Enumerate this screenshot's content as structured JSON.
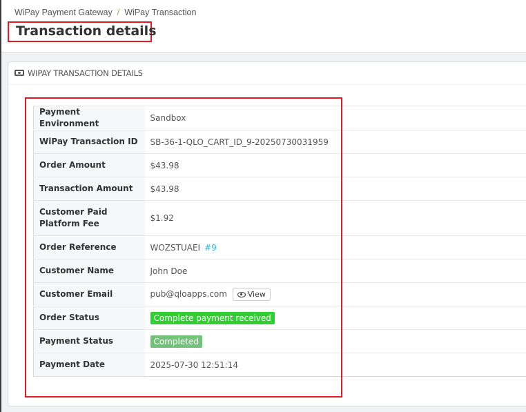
{
  "breadcrumb": {
    "items": [
      "WiPay Payment Gateway",
      "WiPay Transaction"
    ],
    "separator": "/"
  },
  "page": {
    "title": "Transaction details"
  },
  "panel": {
    "title": "WIPAY TRANSACTION DETAILS",
    "icon": "money-icon"
  },
  "details": {
    "payment_environment": {
      "label": "Payment Environment",
      "value": "Sandbox"
    },
    "transaction_id": {
      "label": "WiPay Transaction ID",
      "value": "SB-36-1-QLO_CART_ID_9-20250730031959"
    },
    "order_amount": {
      "label": "Order Amount",
      "value": "$43.98"
    },
    "transaction_amount": {
      "label": "Transaction Amount",
      "value": "$43.98"
    },
    "platform_fee": {
      "label": "Customer Paid Platform Fee",
      "value": "$1.92"
    },
    "order_reference": {
      "label": "Order Reference",
      "value": "WOZSTUAEI",
      "link": "#9"
    },
    "customer_name": {
      "label": "Customer Name",
      "value": "John Doe"
    },
    "customer_email": {
      "label": "Customer Email",
      "value": "pub@qloapps.com",
      "button": "View"
    },
    "order_status": {
      "label": "Order Status",
      "value": "Complete payment received",
      "color": "#32cd32"
    },
    "payment_status": {
      "label": "Payment Status",
      "value": "Completed",
      "color": "#72c279"
    },
    "payment_date": {
      "label": "Payment Date",
      "value": "2025-07-30 12:51:14"
    }
  },
  "colors": {
    "highlight": "#e01b24",
    "link": "#25b9d7",
    "breadcrumb_separator": "#7cb342"
  }
}
